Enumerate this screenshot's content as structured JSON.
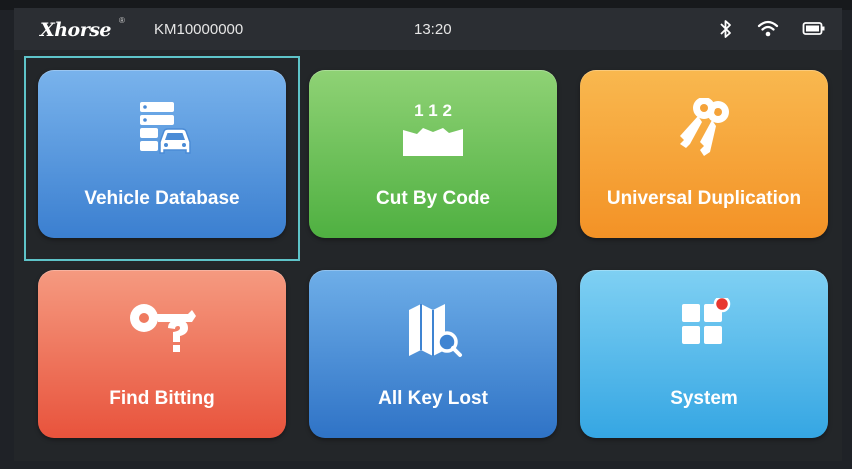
{
  "status_bar": {
    "brand": "Xhorse",
    "brand_mark": "®",
    "serial": "KM10000000",
    "time": "13:20",
    "icons": [
      "bluetooth-icon",
      "wifi-icon",
      "battery-icon"
    ]
  },
  "menu": {
    "selected_index": 0,
    "tiles": [
      {
        "label": "Vehicle Database",
        "icon": "vehicle-database-icon",
        "color_top": "#79b3ec",
        "color_bottom": "#3b7fd0"
      },
      {
        "label": "Cut By Code",
        "icon": "cut-by-code-icon",
        "icon_text": "1 1 2",
        "color_top": "#8fd275",
        "color_bottom": "#4fb041"
      },
      {
        "label": "Universal Duplication",
        "icon": "keys-icon",
        "color_top": "#f9b84f",
        "color_bottom": "#f39226"
      },
      {
        "label": "Find Bitting",
        "icon": "key-question-icon",
        "color_top": "#f59a80",
        "color_bottom": "#e8533c"
      },
      {
        "label": "All Key Lost",
        "icon": "map-search-icon",
        "color_top": "#6eaee8",
        "color_bottom": "#2f73c6"
      },
      {
        "label": "System",
        "icon": "grid-icon",
        "color_top": "#7fd0f3",
        "color_bottom": "#35a6e3",
        "notification_color": "#e8382f"
      }
    ]
  }
}
